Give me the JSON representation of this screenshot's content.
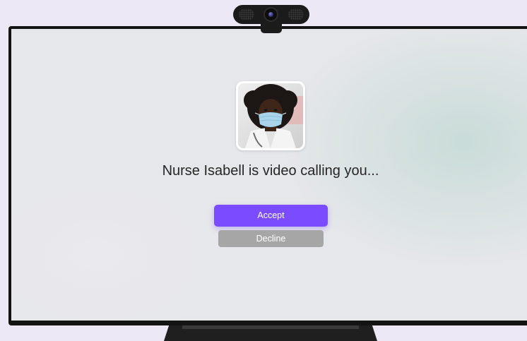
{
  "call": {
    "caller_name": "Nurse Isabell",
    "message": "Nurse Isabell is video calling you..."
  },
  "actions": {
    "accept_label": "Accept",
    "decline_label": "Decline"
  },
  "colors": {
    "accent": "#7b4cff",
    "decline": "#a6a6a6",
    "background": "#ece8f5",
    "screen": "#e6e7ea"
  },
  "icons": {
    "webcam": "webcam-icon",
    "avatar": "caller-avatar"
  }
}
